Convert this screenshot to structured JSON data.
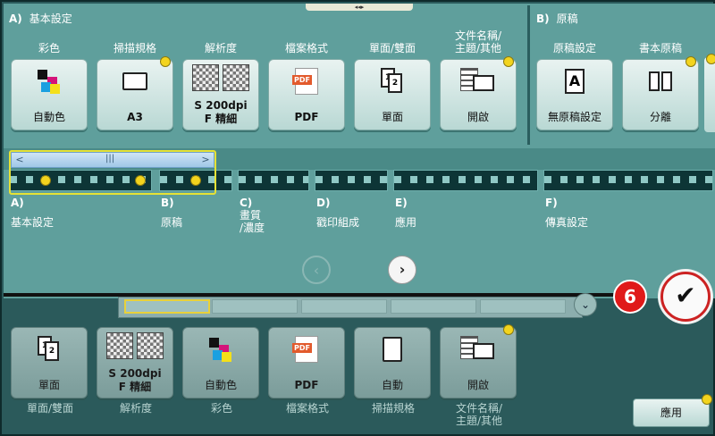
{
  "top_indicator": "◂◂▸",
  "sections": {
    "basic": {
      "prefix": "A)",
      "title": "基本設定"
    },
    "original": {
      "prefix": "B)",
      "title": "原稿"
    }
  },
  "top_tiles": [
    {
      "label": "彩色",
      "value": "自動色",
      "icon": "color-icon",
      "dot": false
    },
    {
      "label": "掃描規格",
      "value": "A3",
      "icon": "paper-size-icon",
      "dot": true
    },
    {
      "label": "解析度",
      "value": "S 200dpi\nF 精細",
      "icon": "resolution-icon",
      "dot": false
    },
    {
      "label": "檔案格式",
      "value": "PDF",
      "icon": "pdf-icon",
      "dot": false
    },
    {
      "label": "單面/雙面",
      "value": "單面",
      "icon": "duplex-icon",
      "dot": false
    },
    {
      "label": "文件名稱/\n主題/其他",
      "value": "開啟",
      "icon": "document-mail-icon",
      "dot": true
    },
    {
      "label": "原稿設定",
      "value": "無原稿設定",
      "icon": "original-setting-icon",
      "dot": false
    },
    {
      "label": "書本原稿",
      "value": "分離",
      "icon": "book-icon",
      "dot": true
    }
  ],
  "nav_groups": [
    {
      "prefix": "A)",
      "label": "基本設定"
    },
    {
      "prefix": "B)",
      "label": "原稿"
    },
    {
      "prefix": "C)",
      "label": "畫質\n/濃度"
    },
    {
      "prefix": "D)",
      "label": "戳印組成"
    },
    {
      "prefix": "E)",
      "label": "應用"
    },
    {
      "prefix": "F)",
      "label": "傳真設定"
    }
  ],
  "step_number": "6",
  "confirm_symbol": "✔",
  "bottom_tiles": [
    {
      "label": "單面/雙面",
      "value": "單面",
      "icon": "duplex-icon",
      "dot": false
    },
    {
      "label": "解析度",
      "value": "S 200dpi\nF 精細",
      "icon": "resolution-icon",
      "dot": false
    },
    {
      "label": "彩色",
      "value": "自動色",
      "icon": "color-icon",
      "dot": false
    },
    {
      "label": "檔案格式",
      "value": "PDF",
      "icon": "pdf-icon",
      "dot": false
    },
    {
      "label": "掃描規格",
      "value": "自動",
      "icon": "paper-size-icon",
      "dot": false
    },
    {
      "label": "文件名稱/\n主題/其他",
      "value": "開啟",
      "icon": "document-mail-icon",
      "dot": true
    }
  ],
  "apply_label": "應用",
  "colors": {
    "accent_yellow": "#f3d41e",
    "step_red": "#e01919",
    "panel": "#5f9f9c"
  }
}
